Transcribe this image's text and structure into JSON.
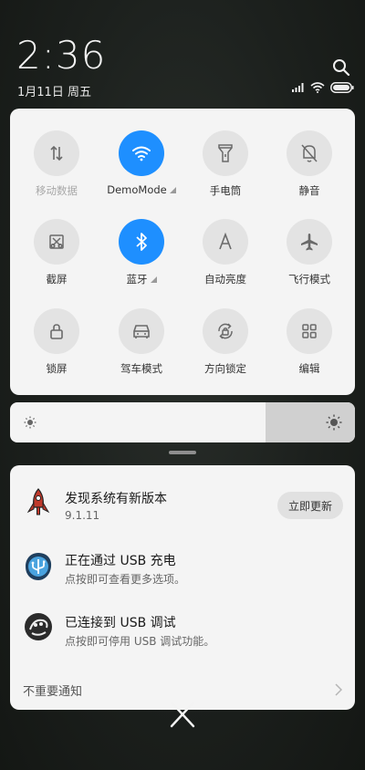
{
  "status": {
    "time": "2:36",
    "date": "1月11日 周五"
  },
  "quick_settings": [
    {
      "label": "移动数据",
      "icon": "mobile-data-icon",
      "active": false,
      "dim": true
    },
    {
      "label": "DemoMode",
      "icon": "wifi-icon",
      "active": true,
      "dim": false,
      "has_triangle": true
    },
    {
      "label": "手电筒",
      "icon": "flashlight-icon",
      "active": false,
      "dim": false
    },
    {
      "label": "静音",
      "icon": "mute-bell-icon",
      "active": false,
      "dim": false
    },
    {
      "label": "截屏",
      "icon": "screenshot-icon",
      "active": false,
      "dim": false
    },
    {
      "label": "蓝牙",
      "icon": "bluetooth-icon",
      "active": true,
      "dim": false,
      "has_triangle": true
    },
    {
      "label": "自动亮度",
      "icon": "auto-brightness-icon",
      "active": false,
      "dim": false
    },
    {
      "label": "飞行模式",
      "icon": "airplane-icon",
      "active": false,
      "dim": false
    },
    {
      "label": "锁屏",
      "icon": "lock-icon",
      "active": false,
      "dim": false
    },
    {
      "label": "驾车模式",
      "icon": "car-icon",
      "active": false,
      "dim": false
    },
    {
      "label": "方向锁定",
      "icon": "rotation-lock-icon",
      "active": false,
      "dim": false
    },
    {
      "label": "编辑",
      "icon": "grid-edit-icon",
      "active": false,
      "dim": false
    }
  ],
  "brightness": {
    "level": 0.74
  },
  "notifications": [
    {
      "title": "发现系统有新版本",
      "subtitle": "9.1.11",
      "button": "立即更新",
      "icon": "rocket-icon"
    },
    {
      "title": "正在通过  USB  充电",
      "subtitle": "点按即可查看更多选项。",
      "icon": "usb-icon"
    },
    {
      "title": "已连接到  USB  调试",
      "subtitle": "点按即可停用 USB 调试功能。",
      "icon": "android-debug-icon"
    }
  ],
  "unimportant": {
    "label": "不重要通知"
  },
  "colors": {
    "accent": "#1e8fff",
    "panel": "#f4f4f4",
    "tile_inactive": "#e3e3e3"
  }
}
